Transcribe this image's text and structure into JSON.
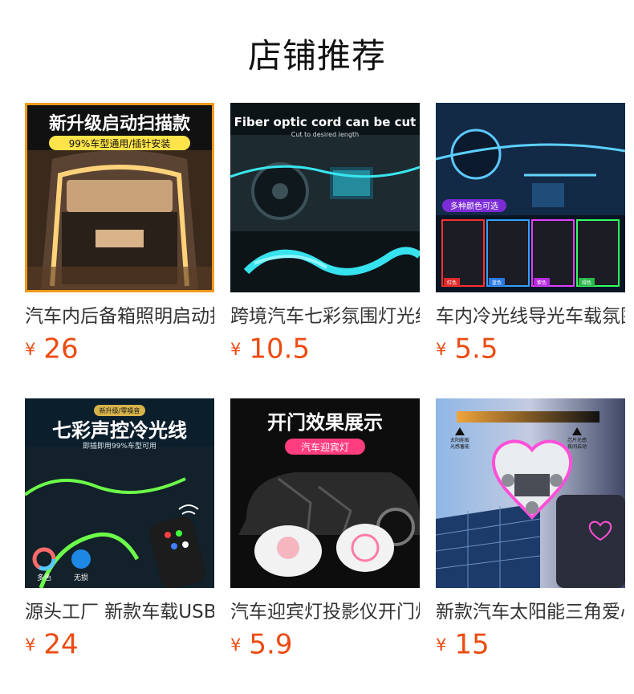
{
  "section_title": "店铺推荐",
  "currency_symbol": "¥",
  "accent_color": "#ec4b12",
  "products": [
    {
      "name": "汽车内后备箱照明启动扫描灯",
      "price": "26",
      "image": {
        "headline": "新升级启动扫描款",
        "subline": "99%车型通用/插针安装"
      }
    },
    {
      "name": "跨境汽车七彩氛围灯光纤",
      "price": "10.5",
      "image": {
        "headline": "Fiber optic cord can be cut",
        "subline": "Cut to desired length"
      }
    },
    {
      "name": "车内冷光线导光车载氛围灯",
      "price": "5.5",
      "image": {
        "badge": "多种颜色可选",
        "swatches": [
          "红色",
          "蓝色",
          "紫色",
          "绿色"
        ]
      }
    },
    {
      "name": "源头工厂 新款车载USB冷光线",
      "price": "24",
      "image": {
        "tag": "新升级/零噪音",
        "headline": "七彩声控冷光线",
        "subline": "即插即用99%车型可用",
        "feature1": "多色",
        "feature2": "无损"
      }
    },
    {
      "name": "汽车迎宾灯投影仪开门灯",
      "price": "5.9",
      "image": {
        "headline": "开门效果展示",
        "badge": "汽车迎宾灯"
      }
    },
    {
      "name": "新款汽车太阳能三角爱心氛围灯",
      "price": "15",
      "image": {
        "label1a": "太阳能板",
        "label1b": "光感蓄能",
        "label2a": "芯片光感",
        "label2b": "夜间启动"
      }
    }
  ]
}
